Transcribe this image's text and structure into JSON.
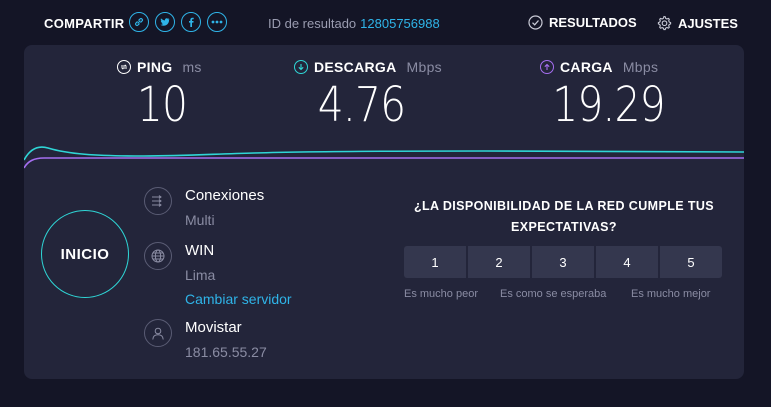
{
  "header": {
    "share_label": "COMPARTIR",
    "share_icons": [
      "link-icon",
      "twitter-icon",
      "facebook-icon",
      "more-icon"
    ],
    "result_id_label": "ID de resultado",
    "result_id_value": "12805756988",
    "results_label": "RESULTADOS",
    "settings_label": "AJUSTES"
  },
  "metrics": {
    "ping": {
      "label": "PING",
      "unit": "ms",
      "value": "10"
    },
    "download": {
      "label": "DESCARGA",
      "unit": "Mbps",
      "value": "4.76"
    },
    "upload": {
      "label": "CARGA",
      "unit": "Mbps",
      "value": "19.29"
    }
  },
  "colors": {
    "accent": "#2fb4e8",
    "download": "#2fd6d6",
    "upload": "#a56ef0",
    "card": "#23253a",
    "background": "#141526"
  },
  "start_button": {
    "label": "INICIO"
  },
  "connection": {
    "connections_label": "Conexiones",
    "connections_value": "Multi",
    "server_name": "WIN",
    "server_location": "Lima",
    "change_server_label": "Cambiar servidor",
    "isp_name": "Movistar",
    "ip_address": "181.65.55.27"
  },
  "survey": {
    "question": "¿LA DISPONIBILIDAD DE LA RED CUMPLE TUS EXPECTATIVAS?",
    "options": [
      "1",
      "2",
      "3",
      "4",
      "5"
    ],
    "scale_low": "Es mucho peor",
    "scale_mid": "Es como se esperaba",
    "scale_high": "Es mucho mejor"
  }
}
